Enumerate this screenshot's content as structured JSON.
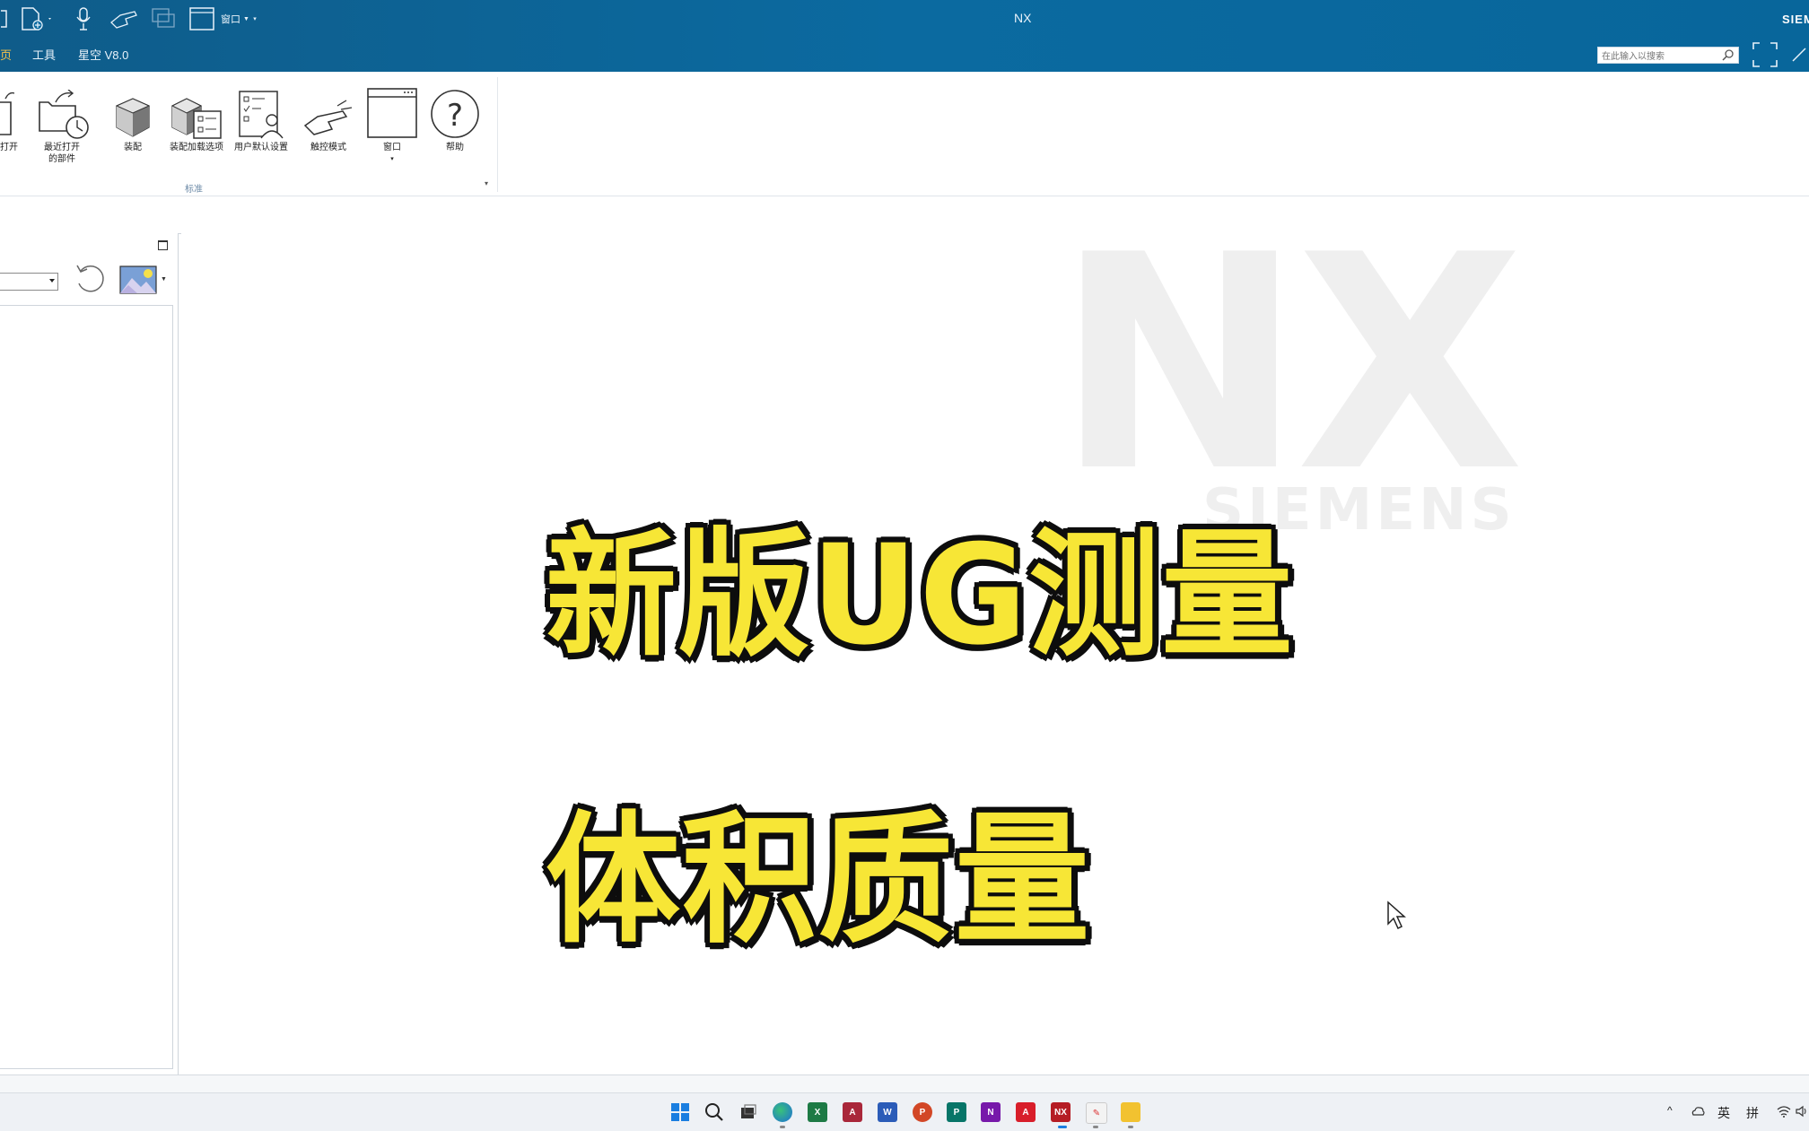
{
  "window": {
    "app_title": "NX",
    "brand": "SIEMENS",
    "window_dropdown_label": "窗口"
  },
  "tabs": [
    {
      "label": "页"
    },
    {
      "label": "工具"
    },
    {
      "label": "星空 V8.0"
    }
  ],
  "search": {
    "placeholder": "在此输入以搜索"
  },
  "ribbon": {
    "buttons": [
      {
        "label": "打开",
        "icon": "open-folder-icon"
      },
      {
        "label": "最近打开\n的部件",
        "icon": "recent-parts-icon"
      },
      {
        "label": "装配",
        "icon": "assembly-icon"
      },
      {
        "label": "装配加载选项",
        "icon": "assembly-load-options-icon"
      },
      {
        "label": "用户默认设置",
        "icon": "user-defaults-icon"
      },
      {
        "label": "触控模式",
        "icon": "touch-mode-icon"
      },
      {
        "label": "窗口",
        "icon": "window-icon"
      },
      {
        "label": "帮助",
        "icon": "help-icon"
      }
    ],
    "group_label": "标准"
  },
  "graphics": {
    "watermark_logo": "NX",
    "watermark_sub": "SIEMENS",
    "overlay_line1": "新版UG测量",
    "overlay_line2": "体积质量"
  },
  "taskbar": {
    "tray_ime_lang": "英",
    "tray_ime_mode": "拼",
    "apps": [
      "start-icon",
      "search-icon",
      "task-view-icon",
      "edge-icon",
      "excel-icon",
      "access-icon",
      "word-icon",
      "powerpoint-icon",
      "publisher-icon",
      "onenote-icon",
      "autocad-icon",
      "nx-icon",
      "paint-icon",
      "file-explorer-icon"
    ]
  },
  "colors": {
    "titlebar": "#0b6aa0",
    "overlay_fill": "#f7e636",
    "overlay_stroke": "#0d0d0d",
    "watermark": "#efefef"
  }
}
